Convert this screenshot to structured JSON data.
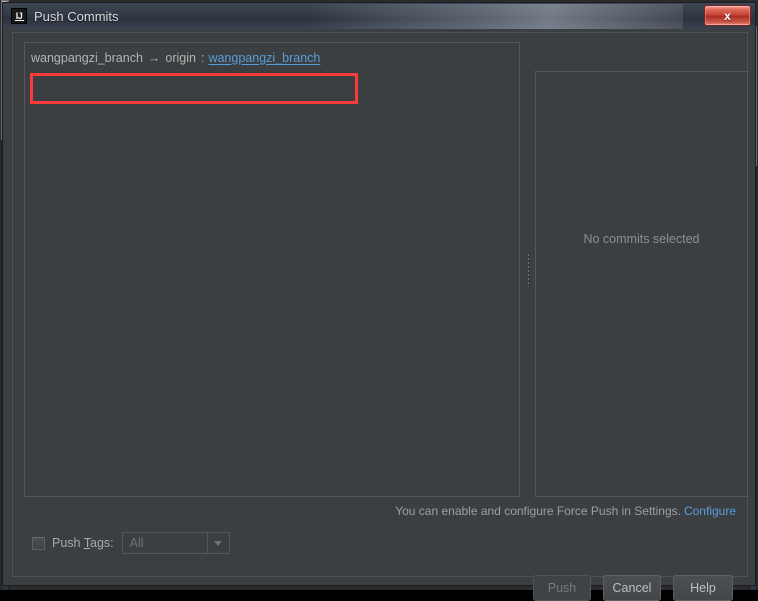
{
  "window": {
    "title": "Push Commits",
    "app_icon": "IJ",
    "close_label": "x",
    "close_icon": "close-icon"
  },
  "commits_panel": {
    "repo_row": {
      "source_branch": "wangpangzi_branch",
      "arrow": "→",
      "remote": "origin",
      "separator": ":",
      "target_branch": "wangpangzi_branch"
    }
  },
  "toolbar": {
    "buttons": [
      {
        "name": "show-diff-icon",
        "enabled": false,
        "selected": false
      },
      {
        "name": "edit-commit-message-icon",
        "enabled": false,
        "selected": false
      },
      {
        "name": "group-by-directory-icon",
        "enabled": true,
        "selected": true
      },
      {
        "name": "collapse-all-icon",
        "enabled": true,
        "selected": false
      },
      {
        "name": "expand-all-icon",
        "enabled": true,
        "selected": false
      }
    ]
  },
  "detail_panel": {
    "empty_text": "No commits selected"
  },
  "force_push": {
    "hint_text": "You can enable and configure Force Push in Settings.",
    "link_label": "Configure"
  },
  "push_tags": {
    "label_before": "Push ",
    "label_mnemonic": "T",
    "label_after": "ags:",
    "checked": false,
    "select_value": "All",
    "select_enabled": false
  },
  "buttons": {
    "push": "Push",
    "cancel": "Cancel",
    "help": "Help",
    "push_enabled": false
  },
  "colors": {
    "link": "#5a9ddb",
    "annotation": "#fb3b3b",
    "panel_bg": "#3c3f41",
    "accent_orange": "#d99a3a",
    "accent_blue": "#5a9ddb"
  }
}
